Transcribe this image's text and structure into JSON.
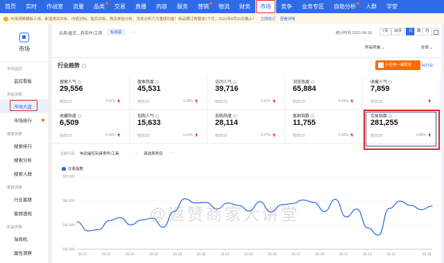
{
  "nav": {
    "items": [
      {
        "label": "首页",
        "active": false,
        "dot": false
      },
      {
        "label": "实时",
        "active": false,
        "dot": false
      },
      {
        "label": "作战室",
        "active": false,
        "dot": false
      },
      {
        "label": "流量",
        "active": false,
        "dot": false
      },
      {
        "label": "品类",
        "active": false,
        "dot": true
      },
      {
        "label": "交易",
        "active": false,
        "dot": false
      },
      {
        "label": "直播",
        "active": false,
        "dot": false
      },
      {
        "label": "内容",
        "active": false,
        "dot": false
      },
      {
        "label": "服务",
        "active": false,
        "dot": false
      },
      {
        "label": "营销",
        "active": false,
        "dot": true
      },
      {
        "label": "物流",
        "active": false,
        "dot": false
      },
      {
        "label": "财务",
        "active": false,
        "dot": false
      },
      {
        "label": "市场",
        "active": true,
        "dot": false
      },
      {
        "label": "竞争",
        "active": false,
        "dot": false
      },
      {
        "label": "业务专区",
        "active": false,
        "dot": false
      },
      {
        "label": "自助分析",
        "active": false,
        "dot": true
      },
      {
        "label": "人群",
        "active": false,
        "dot": false
      },
      {
        "label": "学堂",
        "active": false,
        "dot": false
      }
    ]
  },
  "notice": {
    "text": "市场洞察模板上线，新增类目对标、内容对标、售后对标、购买体验分析、洗发分析六大重磅功能！新品期订购赠送1个月，2022年8月31日截止！",
    "link": "立即抢订",
    "link2": "查看详情"
  },
  "sidebar": {
    "title": "市场",
    "groups": [
      {
        "label": "市场监控",
        "items": [
          {
            "label": "监控看板",
            "active": false,
            "dot": false
          }
        ]
      },
      {
        "label": "供给洞察",
        "items": [
          {
            "label": "市场大盘",
            "active": true,
            "dot": false
          },
          {
            "label": "市场排行",
            "active": false,
            "dot": true
          }
        ]
      },
      {
        "label": "搜索洞察",
        "items": [
          {
            "label": "搜索排行",
            "active": false,
            "dot": false
          },
          {
            "label": "搜索分析",
            "active": false,
            "dot": false
          },
          {
            "label": "搜索人群",
            "active": false,
            "dot": false
          }
        ]
      },
      {
        "label": "客群洞察",
        "items": [
          {
            "label": "行业客群",
            "active": false,
            "dot": false
          },
          {
            "label": "客群透视",
            "active": false,
            "dot": false
          }
        ]
      },
      {
        "label": "机会洞察",
        "items": [
          {
            "label": "淘商机",
            "active": false,
            "dot": false
          },
          {
            "label": "属性洞察",
            "active": false,
            "dot": false
          }
        ]
      }
    ]
  },
  "toolbar": {
    "breadcrumb": "玩具/童车...具零件/工具",
    "tag": "标准版",
    "stat_time": "统计时间 2022-06-18",
    "ranges": [
      "7天",
      "30天",
      "日",
      "周",
      "月"
    ],
    "selected_range": "日",
    "device": "所有终端",
    "scope": "全部"
  },
  "panel": {
    "title": "行业趋势",
    "convert_button": "小旺神一键转化",
    "ai_link": "AI行业"
  },
  "metrics": [
    {
      "label": "搜索人气",
      "value": "29,556",
      "compare": "较前1日",
      "pct": "3.41%"
    },
    {
      "label": "搜索热度",
      "value": "45,531",
      "compare": "较前1日",
      "pct": "4.36%"
    },
    {
      "label": "访问人气",
      "value": "39,716",
      "compare": "较前1日",
      "pct": "3.91%"
    },
    {
      "label": "浏览热度",
      "value": "65,884",
      "compare": "较前1日",
      "pct": "4.29%"
    },
    {
      "label": "收藏人气",
      "value": "7,859",
      "compare": "较前1日",
      "pct": ""
    },
    {
      "label": "收藏热度",
      "value": "6,509",
      "compare": "较前1日",
      "pct": "5.40%"
    },
    {
      "label": "加购人气",
      "value": "15,633",
      "compare": "较前1日",
      "pct": "5.01%"
    },
    {
      "label": "加购热度",
      "value": "28,114",
      "compare": "较前1日",
      "pct": "5.07%"
    },
    {
      "label": "客群指数",
      "value": "11,755",
      "compare": "较前1日",
      "pct": "5.48%"
    },
    {
      "label": "交易指数",
      "value": "281,255",
      "compare": "较前1日",
      "pct": "0.85%"
    }
  ],
  "filters": {
    "label": "当前行业",
    "industry": "电动遥控玩具零件/工具",
    "compare": "请选择类目"
  },
  "watermark": "@返赞商家大讲堂",
  "colors": {
    "primary": "#2e6be6",
    "accent": "#ff6a00",
    "highlight": "#e02020"
  },
  "chart_data": {
    "type": "line",
    "series": [
      {
        "name": "交易指数",
        "values": [
          245000,
          230000,
          232000,
          247000,
          252000,
          240000,
          248000,
          251000,
          236000,
          262000,
          283000,
          276000,
          277000,
          266000,
          276000,
          272000,
          263000,
          278000,
          261000,
          273000,
          275000,
          281000,
          277000,
          262000,
          282000,
          253000,
          266000,
          235000,
          223000,
          267000,
          279000,
          272000,
          265000,
          271000
        ]
      }
    ],
    "x": [
      "05-20",
      "05-21",
      "05-22",
      "05-23",
      "05-24",
      "05-25",
      "05-26",
      "05-27",
      "05-28",
      "05-29",
      "05-30",
      "05-31",
      "06-01",
      "06-02",
      "06-03",
      "06-04",
      "06-05",
      "06-06",
      "06-07",
      "06-08",
      "06-09",
      "06-10",
      "06-11",
      "06-12",
      "06-13",
      "06-14",
      "06-15",
      "06-16",
      "06-17",
      "06-18"
    ],
    "x_ticks": [
      "05-20",
      "05-22",
      "05-24",
      "05-26",
      "05-28",
      "05-30",
      "06-01",
      "06-03",
      "06-05",
      "06-07",
      "06-09",
      "06-11",
      "06-13",
      "06-15",
      "06-18"
    ],
    "y_ticks": [
      "320,000",
      "280,000",
      "240,000",
      "200,000"
    ],
    "ylim": [
      200000,
      320000
    ],
    "grid": true,
    "legend": "top-left"
  }
}
